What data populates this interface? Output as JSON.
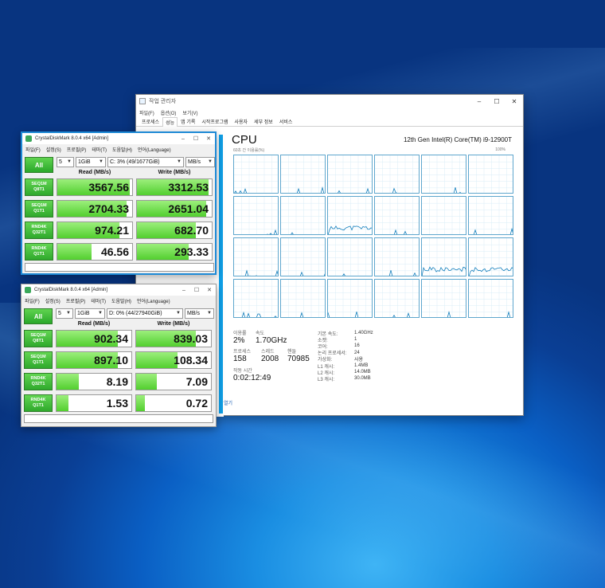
{
  "task_manager": {
    "title": "작업 관리자",
    "menu": [
      "파일(F)",
      "옵션(O)",
      "보기(V)"
    ],
    "tabs": [
      "프로세스",
      "성능",
      "앱 기록",
      "시작프로그램",
      "사용자",
      "세부 정보",
      "서비스"
    ],
    "active_tab": "성능",
    "cpu_title": "CPU",
    "cpu_model": "12th Gen Intel(R) Core(TM) i9-12900T",
    "util_label": "60초 간 이용률(%)",
    "util_max": "100%",
    "stats": {
      "utilization_label": "이용률",
      "utilization": "2%",
      "speed_label": "속도",
      "speed": "1.70GHz",
      "processes_label": "프로세스",
      "processes": "158",
      "threads_label": "스레드",
      "threads": "2008",
      "handles_label": "핸들",
      "handles": "70985",
      "uptime_label": "작동 시간",
      "uptime": "0:02:12:49"
    },
    "details": [
      {
        "k": "기본 속도:",
        "v": "1.40GHz"
      },
      {
        "k": "소켓:",
        "v": "1"
      },
      {
        "k": "코어:",
        "v": "16"
      },
      {
        "k": "논리 프로세서:",
        "v": "24"
      },
      {
        "k": "가상화:",
        "v": "사용"
      },
      {
        "k": "L1 캐시:",
        "v": "1.4MB"
      },
      {
        "k": "L2 캐시:",
        "v": "14.0MB"
      },
      {
        "k": "L3 캐시:",
        "v": "30.0MB"
      }
    ],
    "footer": "열기"
  },
  "cdm1": {
    "title": "CrystalDiskMark 8.0.4 x64 [Admin]",
    "menu": [
      "파일(F)",
      "설정(S)",
      "프로필(P)",
      "테마(T)",
      "도움말(H)",
      "언어(Language)"
    ],
    "all_label": "All",
    "count": "5",
    "size": "1GiB",
    "drive": "C: 3% (49/1677GiB)",
    "unit": "MB/s",
    "read_header": "Read (MB/s)",
    "write_header": "Write (MB/s)",
    "rows": [
      {
        "l1": "SEQ1M",
        "l2": "Q8T1",
        "read": "3567.56",
        "write": "3312.53",
        "read_level": 0.97,
        "write_level": 0.96
      },
      {
        "l1": "SEQ1M",
        "l2": "Q1T1",
        "read": "2704.33",
        "write": "2651.04",
        "read_level": 0.93,
        "write_level": 0.93
      },
      {
        "l1": "RND4K",
        "l2": "Q32T1",
        "read": "974.21",
        "write": "682.70",
        "read_level": 0.83,
        "write_level": 0.79
      },
      {
        "l1": "RND4K",
        "l2": "Q1T1",
        "read": "46.56",
        "write": "293.33",
        "read_level": 0.46,
        "write_level": 0.69
      }
    ]
  },
  "cdm2": {
    "title": "CrystalDiskMark 8.0.4 x64 [Admin]",
    "menu": [
      "파일(F)",
      "설정(S)",
      "프로필(P)",
      "테마(T)",
      "도움말(H)",
      "언어(Language)"
    ],
    "all_label": "All",
    "count": "5",
    "size": "1GiB",
    "drive": "D: 0% (44/27940GiB)",
    "unit": "MB/s",
    "read_header": "Read (MB/s)",
    "write_header": "Write (MB/s)",
    "rows": [
      {
        "l1": "SEQ1M",
        "l2": "Q8T1",
        "read": "902.34",
        "write": "839.03",
        "read_level": 0.82,
        "write_level": 0.8
      },
      {
        "l1": "SEQ1M",
        "l2": "Q1T1",
        "read": "897.10",
        "write": "108.34",
        "read_level": 0.82,
        "write_level": 0.55
      },
      {
        "l1": "RND4K",
        "l2": "Q32T1",
        "read": "8.19",
        "write": "7.09",
        "read_level": 0.3,
        "write_level": 0.28
      },
      {
        "l1": "RND4K",
        "l2": "Q1T1",
        "read": "1.53",
        "write": "0.72",
        "read_level": 0.16,
        "write_level": 0.12
      }
    ]
  },
  "colors": {
    "cdm_green": "#2fa92c",
    "cpu_graph": "#117dbb",
    "accent_blue": "#1e8ad6"
  }
}
